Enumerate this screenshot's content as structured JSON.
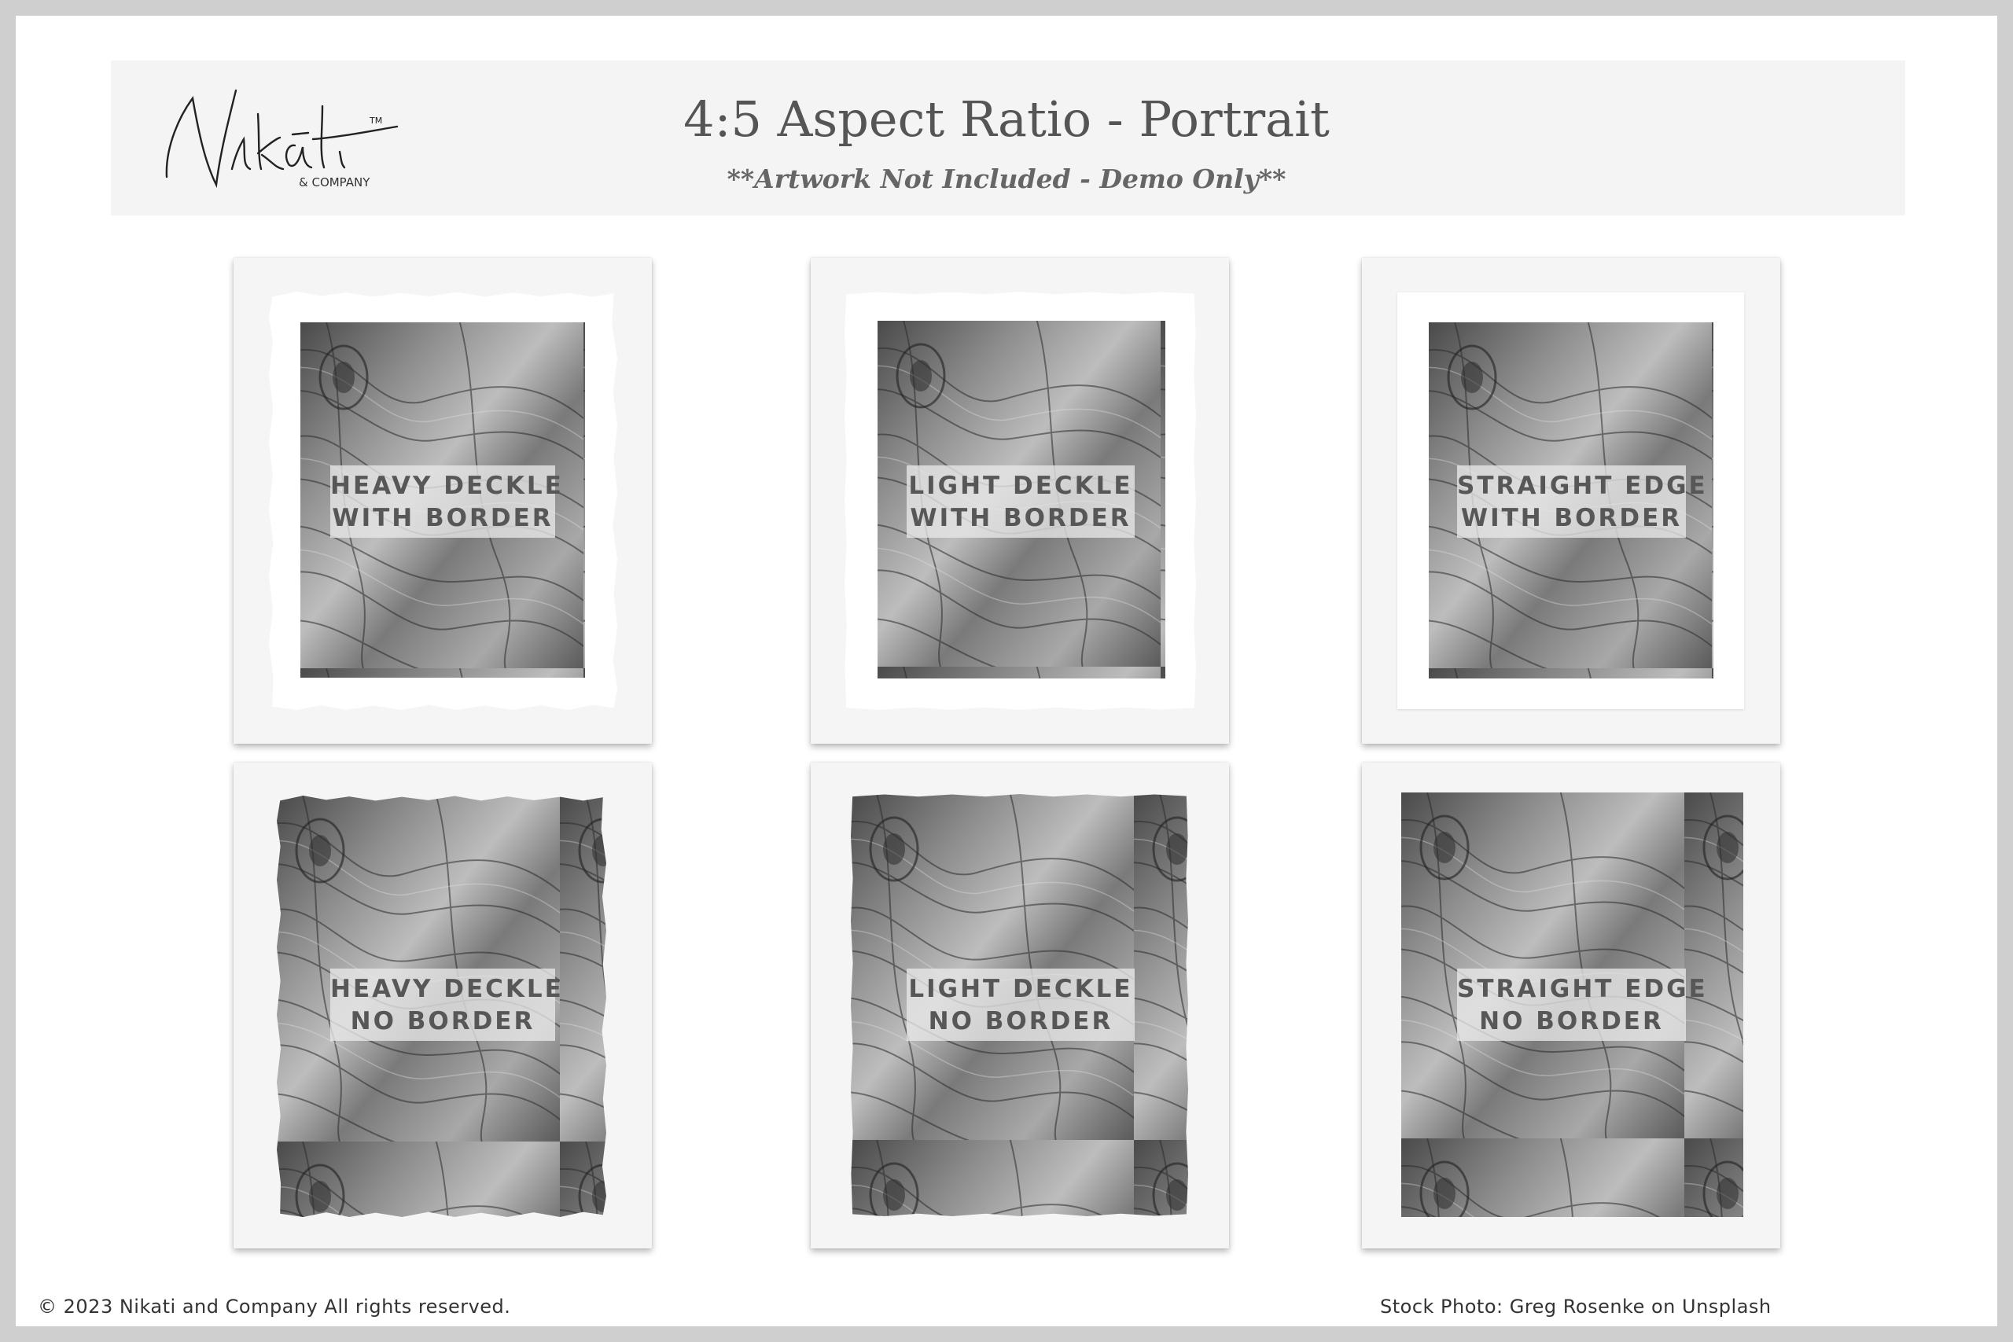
{
  "header": {
    "brand_name": "Nikāti",
    "brand_sub": "& COMPANY",
    "brand_tm": "TM",
    "title": "4:5 Aspect Ratio - Portrait",
    "subtitle": "**Artwork Not Included - Demo Only**"
  },
  "prints": [
    {
      "line1": "HEAVY DECKLE",
      "line2": "WITH BORDER"
    },
    {
      "line1": "LIGHT DECKLE",
      "line2": "WITH BORDER"
    },
    {
      "line1": "STRAIGHT EDGE",
      "line2": "WITH BORDER"
    },
    {
      "line1": "HEAVY DECKLE",
      "line2": "NO BORDER"
    },
    {
      "line1": "LIGHT DECKLE",
      "line2": "NO BORDER"
    },
    {
      "line1": "STRAIGHT EDGE",
      "line2": "NO BORDER"
    }
  ],
  "footer": {
    "copyright": "© 2023 Nikati and Company All rights reserved.",
    "credit": "Stock Photo: Greg Rosenke on Unsplash"
  },
  "colors": {
    "page_bg": "#cfcfcf",
    "sheet": "#ffffff",
    "header_band": "#f4f4f4",
    "card": "#f5f5f5",
    "label_text": "#575757"
  }
}
